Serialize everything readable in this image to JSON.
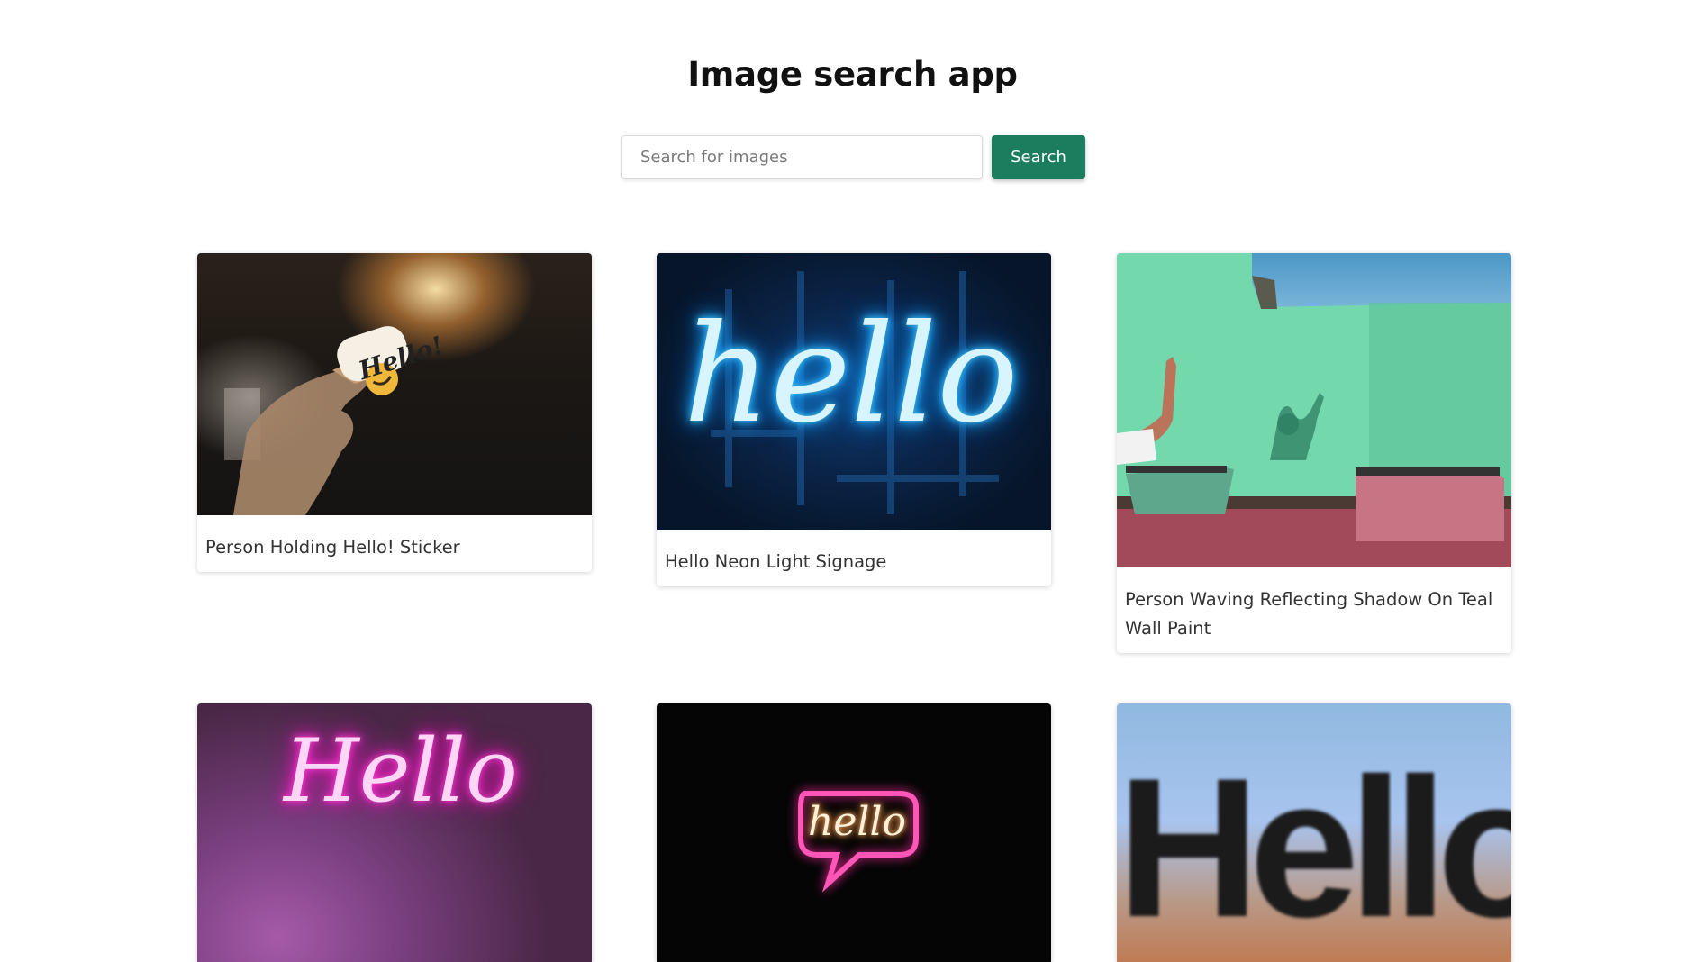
{
  "app": {
    "title": "Image search app"
  },
  "search": {
    "placeholder": "Search for images",
    "value": "",
    "button_label": "Search",
    "button_color": "#1b7d5e"
  },
  "results": [
    {
      "caption": "Person Holding Hello! Sticker",
      "image_text": "Hello!"
    },
    {
      "caption": "Hello Neon Light Signage",
      "image_text": "hello"
    },
    {
      "caption": "Person Waving Reflecting Shadow On Teal Wall Paint"
    },
    {
      "caption": "",
      "image_text": "Hello"
    },
    {
      "caption": "",
      "image_text": "hello"
    },
    {
      "caption": "",
      "image_text": "Hello"
    }
  ]
}
